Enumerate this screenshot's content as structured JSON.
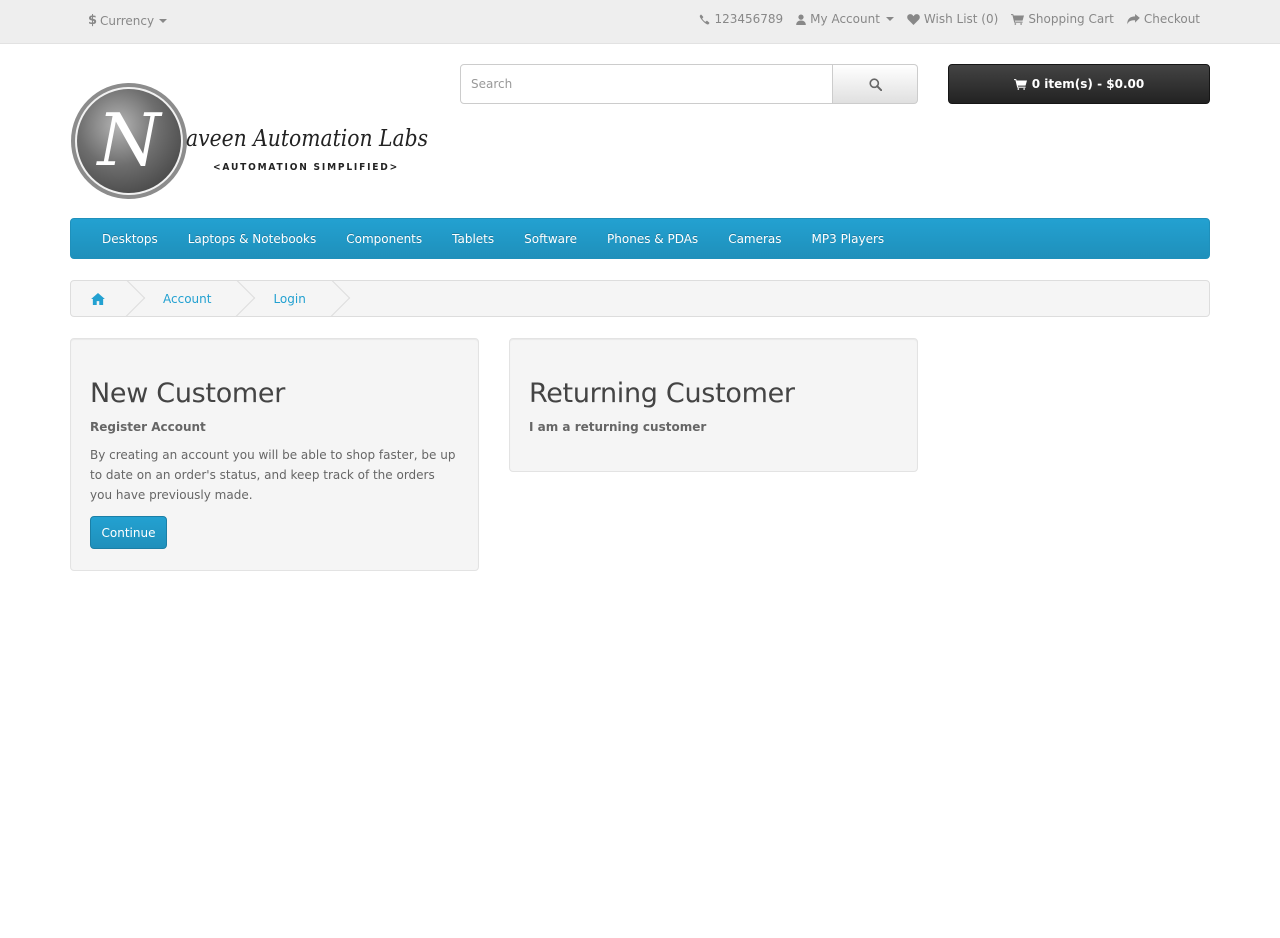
{
  "topbar": {
    "currency_symbol": "$",
    "currency_label": "Currency",
    "phone": "123456789",
    "my_account": "My Account",
    "wishlist": "Wish List (0)",
    "shopping_cart": "Shopping Cart",
    "checkout": "Checkout"
  },
  "logo": {
    "letter": "N",
    "title": "aveen Automation Labs",
    "tagline": "<AUTOMATION SIMPLIFIED>"
  },
  "search": {
    "placeholder": "Search"
  },
  "cart": {
    "label": "0 item(s) - $0.00"
  },
  "menu": {
    "items": [
      "Desktops",
      "Laptops & Notebooks",
      "Components",
      "Tablets",
      "Software",
      "Phones & PDAs",
      "Cameras",
      "MP3 Players"
    ]
  },
  "breadcrumb": {
    "items": [
      "Account",
      "Login"
    ]
  },
  "new_customer": {
    "title": "New Customer",
    "subtitle": "Register Account",
    "description": "By creating an account you will be able to shop faster, be up to date on an order's status, and keep track of the orders you have previously made.",
    "button": "Continue"
  },
  "returning_customer": {
    "title": "Returning Customer",
    "subtitle": "I am a returning customer"
  },
  "colors": {
    "accent": "#23a1d1",
    "topbar_bg": "#eeeeee",
    "cart_bg": "#333333"
  }
}
